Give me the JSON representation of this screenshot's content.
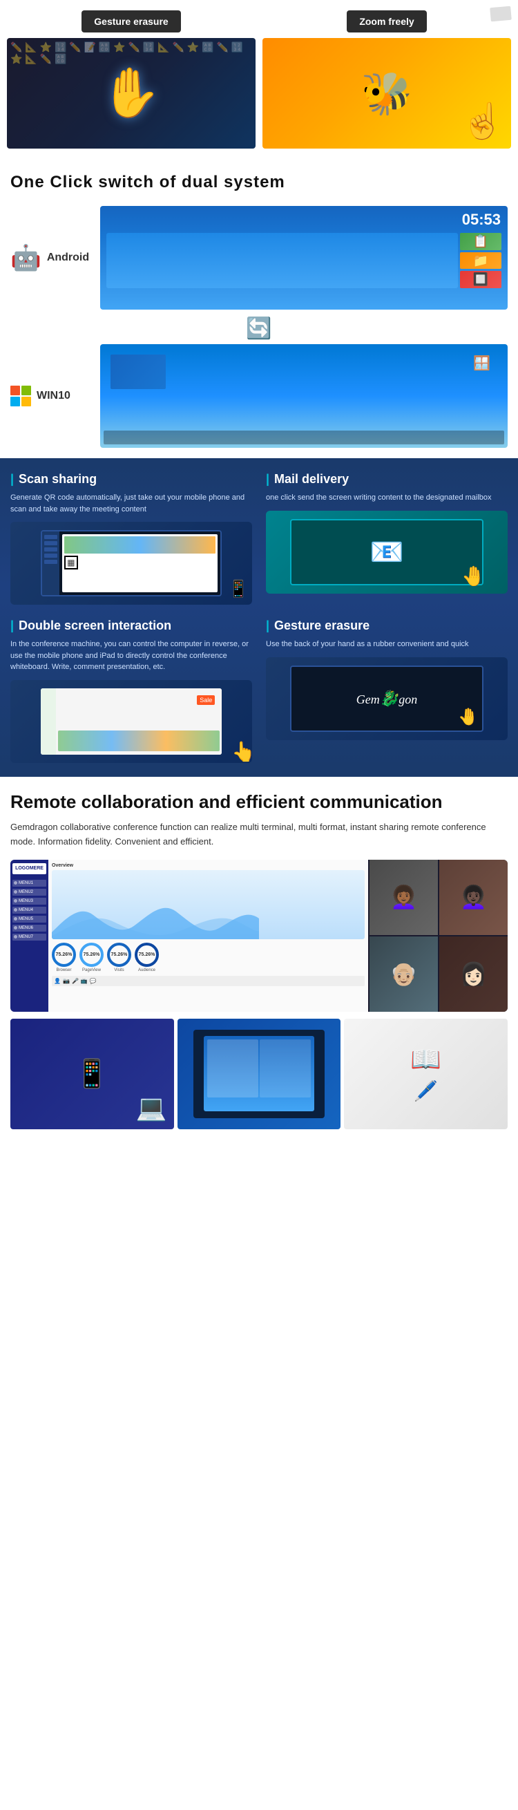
{
  "gestures": {
    "erase": {
      "label": "Gesture erasure",
      "emoji": "✋"
    },
    "zoom": {
      "label": "Zoom freely",
      "emoji": "🐝"
    }
  },
  "dual_system": {
    "title": "One Click switch of dual system",
    "android": {
      "name": "Android",
      "time": "05:53"
    },
    "windows": {
      "name": "WIN10"
    }
  },
  "features": [
    {
      "id": "scan-sharing",
      "title": "Scan sharing",
      "bar": "| ",
      "desc": "Generate QR code automatically, just take out your mobile phone and scan and take away the meeting content"
    },
    {
      "id": "mail-delivery",
      "title": "Mail delivery",
      "bar": "| ",
      "desc": "one click send the screen writing content to the designated mailbox"
    },
    {
      "id": "double-screen",
      "title": "Double screen interaction",
      "bar": "| ",
      "desc": "In the conference machine, you can control the computer in reverse, or use the mobile phone and iPad to directly control the conference whiteboard. Write, comment presentation, etc."
    },
    {
      "id": "gesture-erasure",
      "title": "Gesture erasure",
      "bar": "| ",
      "desc": "Use the back of your hand as a rubber convenient and quick"
    }
  ],
  "collab": {
    "title": "Remote collaboration and efficient communication",
    "desc": "Gemdragon collaborative conference function can realize multi terminal, multi format, instant sharing remote conference mode. Information fidelity. Convenient and efficient.",
    "app_logo": "LOGOMERE",
    "menu_items": [
      "MENU1",
      "MENU2",
      "MENU3",
      "MENU4",
      "MENU5",
      "MENU6",
      "MENU7"
    ],
    "stat_values": [
      "75.26%",
      "75.26%",
      "75.26%",
      "75.26%"
    ],
    "stat_labels": [
      "Browser",
      "PageView",
      "Visits",
      "Audience"
    ]
  }
}
